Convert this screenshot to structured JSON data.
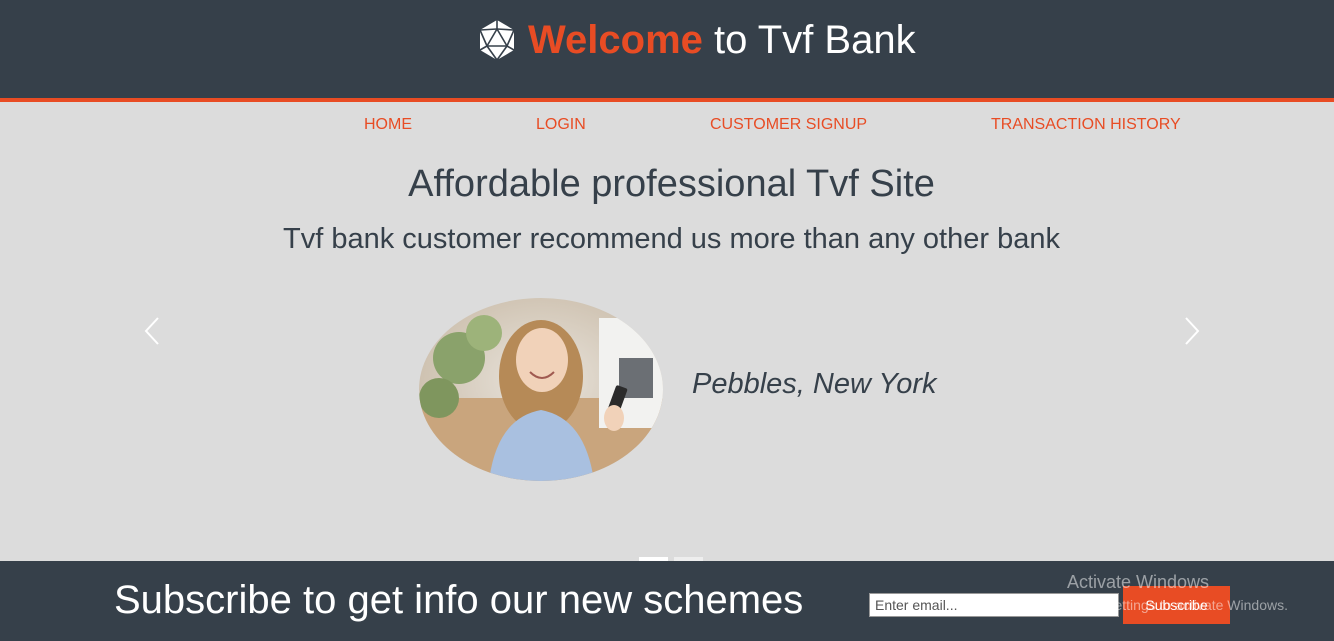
{
  "header": {
    "welcome": "Welcome",
    "rest": " to Tvf Bank",
    "logo_icon": "icosahedron-logo-icon"
  },
  "nav": [
    "HOME",
    "LOGIN",
    "CUSTOMER SIGNUP",
    "TRANSACTION HISTORY"
  ],
  "hero": {
    "title": "Affordable professional Tvf Site",
    "subtitle": "Tvf bank customer recommend us more than any other bank"
  },
  "carousel": {
    "prev_icon": "chevron-left-icon",
    "next_icon": "chevron-right-icon",
    "slide_count": 2,
    "active_slide": 1,
    "testimonial_location": "Pebbles, New York"
  },
  "footer": {
    "title": "Subscribe to get info our new schemes",
    "email_placeholder": "Enter email...",
    "subscribe_label": "Subscribe"
  },
  "watermark": {
    "title": "Activate Windows",
    "subtitle": "Go to Settings to activate Windows."
  },
  "colors": {
    "dark": "#36404a",
    "accent": "#e84c24",
    "background": "#dcdcdc"
  }
}
